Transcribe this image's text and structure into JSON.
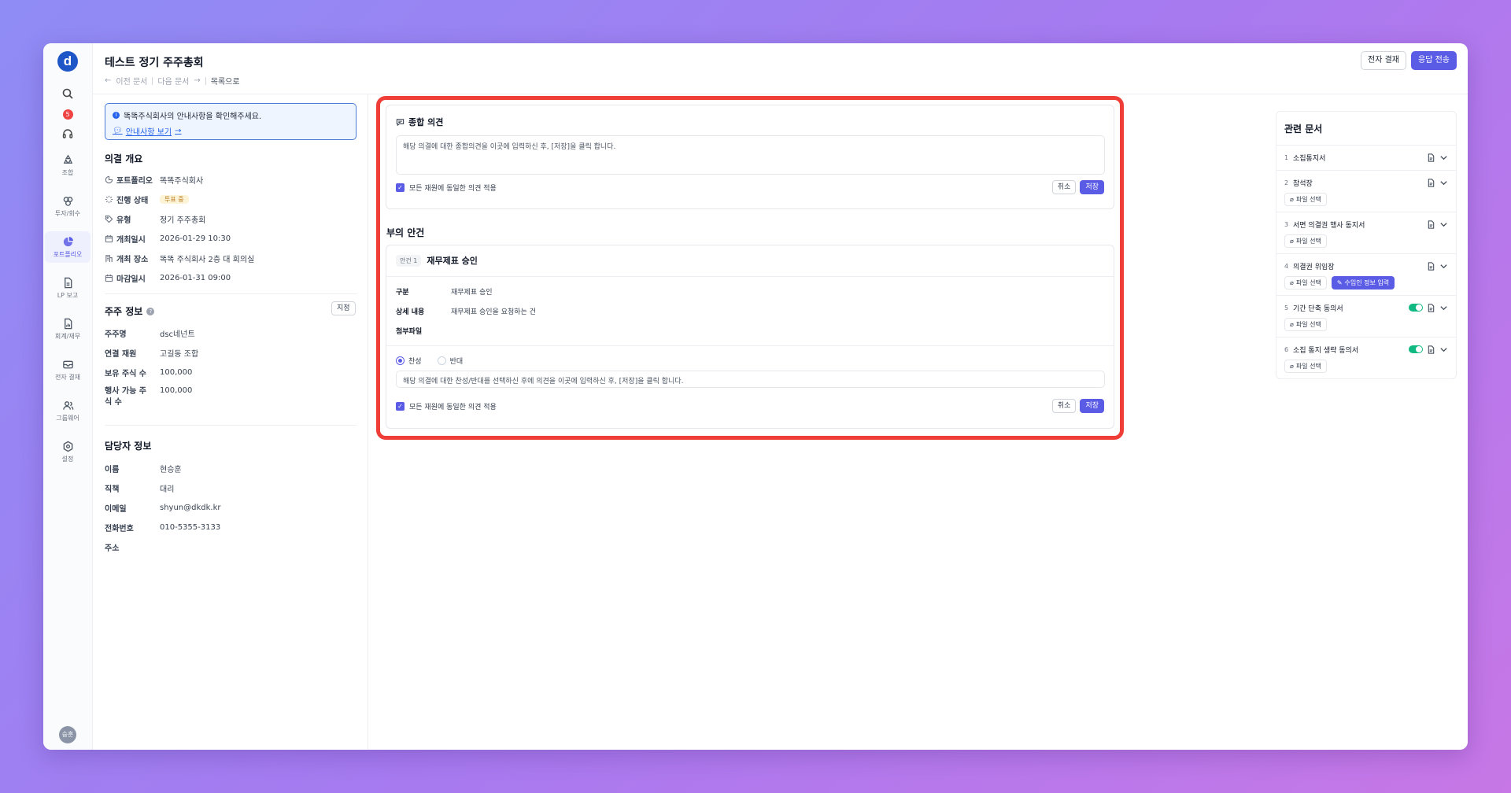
{
  "app": {
    "logo_letter": "d",
    "avatar": "승훈",
    "notif_count": "5"
  },
  "rail": [
    {
      "label": "조합",
      "icon": "recycle-icon"
    },
    {
      "label": "투자/회수",
      "icon": "link-icon"
    },
    {
      "label": "포트폴리오",
      "icon": "pie-chart-icon"
    },
    {
      "label": "LP 보고",
      "icon": "document-icon"
    },
    {
      "label": "회계/재무",
      "icon": "report-icon"
    },
    {
      "label": "전자 결재",
      "icon": "mail-icon"
    },
    {
      "label": "그룹웨어",
      "icon": "users-icon"
    },
    {
      "label": "설정",
      "icon": "gear-icon"
    }
  ],
  "header": {
    "title": "테스트 정기 주주총회",
    "prev": "이전 문서",
    "next": "다음 문서",
    "to_list": "목록으로",
    "btn_approval": "전자 결재",
    "btn_send": "응답 전송"
  },
  "notice": {
    "text": "똑똑주식회사의 안내사항을 확인해주세요.",
    "link": "안내사항 보기"
  },
  "overview": {
    "title": "의결 개요",
    "portfolio_k": "포트폴리오",
    "portfolio_v": "똑똑주식회사",
    "status_k": "진행 상태",
    "status_v": "투표 중",
    "type_k": "유형",
    "type_v": "정기 주주총회",
    "date_k": "개최일시",
    "date_v": "2026-01-29 10:30",
    "place_k": "개최 장소",
    "place_v": "똑똑 주식회사 2층 대 회의실",
    "deadline_k": "마감일시",
    "deadline_v": "2026-01-31 09:00"
  },
  "shareholder": {
    "title": "주주 정보",
    "btn": "지정",
    "name_k": "주주명",
    "name_v": "dsc네넌트",
    "fund_k": "연결 재원",
    "fund_v": "고길동 조합",
    "shares_k": "보유 주식 수",
    "shares_v": "100,000",
    "exercisable_k": "행사 가능 주식 수",
    "exercisable_v": "100,000"
  },
  "manager": {
    "title": "담당자 정보",
    "name_k": "이름",
    "name_v": "현승훈",
    "position_k": "직책",
    "position_v": "대리",
    "email_k": "이메일",
    "email_v": "shyun@dkdk.kr",
    "phone_k": "전화번호",
    "phone_v": "010-5355-3133",
    "address_k": "주소"
  },
  "opinion": {
    "title": "종합 의견",
    "placeholder": "해당 의결에 대한 종합의견을 이곳에 입력하신 후, [저장]을 클릭 합니다.",
    "apply_all": "모든 재원에 동일한 의견 적용",
    "cancel": "취소",
    "save": "저장"
  },
  "agenda": {
    "section_title": "부의 안건",
    "chip": "안건 1",
    "title": "재무제표 승인",
    "type_k": "구분",
    "type_v": "재무제표 승인",
    "detail_k": "상세 내용",
    "detail_v": "재무제표 승인을 요청하는 건",
    "attach_k": "첨부파일",
    "agree": "찬성",
    "disagree": "반대",
    "placeholder": "해당 의결에 대한 찬성/반대를 선택하신 후에 의견을 이곳에 입력하신 후, [저장]을 클릭 합니다.",
    "apply_all": "모든 재원에 동일한 의견 적용",
    "cancel": "취소",
    "save": "저장"
  },
  "related": {
    "title": "관련 문서",
    "file_btn": "파일 선택",
    "agent_btn": "수임인 정보 입력",
    "items": [
      {
        "num": "1",
        "name": "소집통지서"
      },
      {
        "num": "2",
        "name": "참석장"
      },
      {
        "num": "3",
        "name": "서면 의결권 행사 동지서"
      },
      {
        "num": "4",
        "name": "의결권 위임장"
      },
      {
        "num": "5",
        "name": "기간 단축 동의서"
      },
      {
        "num": "6",
        "name": "소집 통지 생략 동의서"
      }
    ]
  }
}
